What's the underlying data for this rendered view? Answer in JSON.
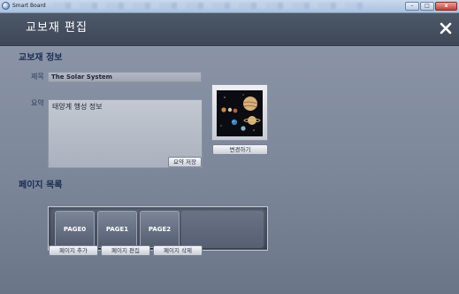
{
  "window": {
    "app_title": "Smart Board",
    "minimize_glyph": "–",
    "maximize_glyph": "□",
    "close_glyph": "x"
  },
  "dialog": {
    "title": "교보재 편집",
    "close_icon": "close-icon"
  },
  "material_info": {
    "section_title": "교보재 정보",
    "title_label": "제목",
    "title_value": "The Solar System",
    "summary_label": "요약",
    "summary_value": "태양계 행성 정보",
    "save_summary_button": "요약 저장",
    "thumbnail_icon": "solar-system-thumbnail",
    "change_button": "변경하기"
  },
  "page_list": {
    "section_title": "페이지 목록",
    "pages": [
      "PAGE0",
      "PAGE1",
      "PAGE2"
    ],
    "add_button": "페이지 추가",
    "edit_button": "페이지 편집",
    "delete_button": "페이지 삭제"
  },
  "colors": {
    "header_bg": "#3d4757",
    "section_title": "#1d2d52",
    "body_bg": "#7b8699"
  }
}
